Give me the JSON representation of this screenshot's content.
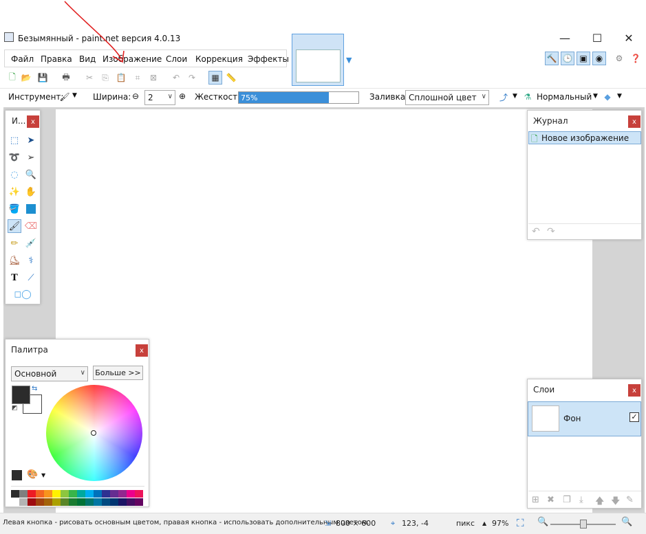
{
  "window": {
    "title": "Безымянный - paint.net версия 4.0.13",
    "controls": {
      "minimize": "—",
      "maximize": "☐",
      "close": "✕"
    }
  },
  "menu": [
    "Файл",
    "Правка",
    "Вид",
    "Изображение",
    "Слои",
    "Коррекция",
    "Эффекты"
  ],
  "toolbar": {
    "tool_label": "Инструмент:",
    "width_label": "Ширина:",
    "width_value": "2",
    "hardness_label": "Жесткость:",
    "hardness_value": "75%",
    "hardness_fraction": 0.75,
    "fill_label": "Заливка:",
    "fill_value": "Сплошной цвет",
    "blend_value": "Нормальный"
  },
  "tools_panel": {
    "title": "И...",
    "close": "x"
  },
  "history_panel": {
    "title": "Журнал",
    "close": "x",
    "items": [
      "Новое изображение"
    ]
  },
  "palette_panel": {
    "title": "Палитра",
    "close": "x",
    "mode": "Основной",
    "more_button": "Больше >>",
    "primary_color": "#2b2b2b",
    "secondary_color": "#ffffff",
    "swatches_top": [
      "#2b2b2b",
      "#7f7f7f",
      "#ed1c24",
      "#f26522",
      "#f7941d",
      "#fff200",
      "#8dc63f",
      "#39b54a",
      "#00a99d",
      "#00aeef",
      "#0072bc",
      "#2e3192",
      "#662d91",
      "#92278f",
      "#ec008c",
      "#ed145b"
    ],
    "swatches_bottom": [
      "#ffffff",
      "#b4b4b4",
      "#9e0b0f",
      "#a0410d",
      "#a36209",
      "#aba000",
      "#598527",
      "#197b30",
      "#007236",
      "#00746b",
      "#0076a3",
      "#004a80",
      "#003471",
      "#1b1464",
      "#440e62",
      "#630460"
    ]
  },
  "layers_panel": {
    "title": "Слои",
    "close": "x",
    "layers": [
      {
        "name": "Фон",
        "visible": true
      }
    ]
  },
  "status": {
    "hint": "Левая кнопка - рисовать основным цветом, правая кнопка - использовать дополнительным цветом.",
    "size": "800 × 600",
    "cursor": "123, -4",
    "units": "пикс",
    "zoom": "97%"
  },
  "colors": {
    "accent": "#3b8fd9",
    "close_red": "#c7403b",
    "selection": "#cde4f7"
  }
}
